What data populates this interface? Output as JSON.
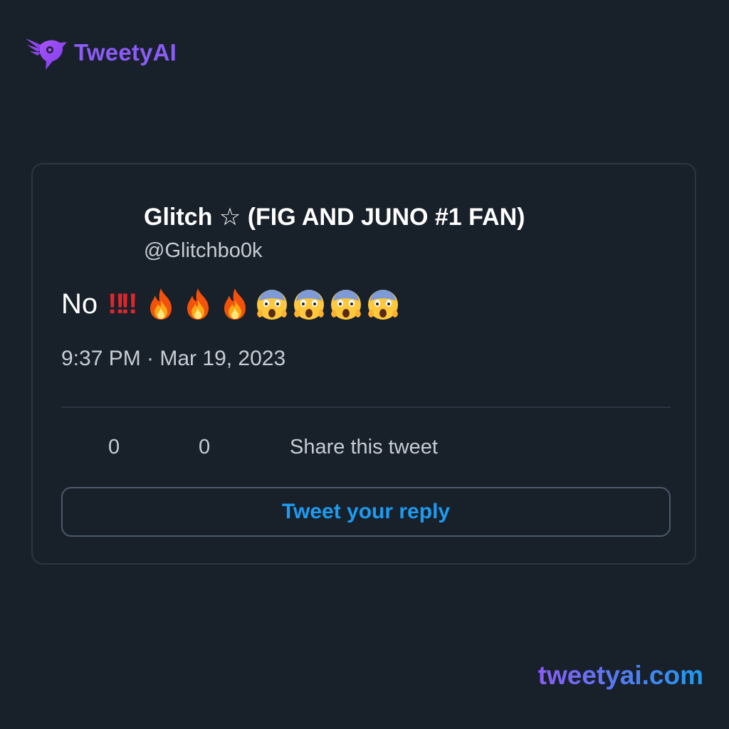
{
  "brand": {
    "name": "TweetyAI",
    "logo_icon": "bird-logo-icon",
    "color": "#8b5cf6"
  },
  "tweet": {
    "author_name": "Glitch ☆ (FIG AND JUNO #1 FAN)",
    "author_handle": "@Glitchbo0k",
    "text": "No",
    "emojis": [
      "bangbang-icon",
      "bangbang-icon",
      "fire-icon",
      "fire-icon",
      "fire-icon",
      "screaming-face-icon",
      "screaming-face-icon",
      "screaming-face-icon",
      "screaming-face-icon"
    ],
    "emoji_glyph_bangbang": "‼‼",
    "timestamp": "9:37 PM · Mar 19, 2023",
    "likes": "0",
    "retweets": "0",
    "share_label": "Share this tweet",
    "reply_label": "Tweet your reply"
  },
  "footer": {
    "url": "tweetyai.com"
  },
  "colors": {
    "background": "#18202a",
    "card_border": "#2c3542",
    "accent_blue": "#1d9bf0",
    "accent_purple": "#8b5cf6"
  }
}
